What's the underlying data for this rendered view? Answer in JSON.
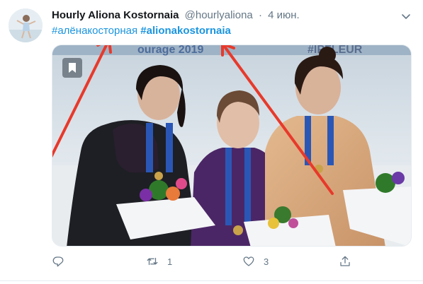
{
  "tweet": {
    "author_name": "Hourly Aliona Kostornaia",
    "handle": "@hourlyaliona",
    "separator": "·",
    "date": "4 июн.",
    "hashtags": [
      {
        "text": "#алёнакосторная",
        "bold": false
      },
      {
        "text": "#alionakostornaia",
        "bold": true
      }
    ]
  },
  "media": {
    "backdrop_text_left": "ourage 2019",
    "backdrop_text_right": "#IPFLEUR",
    "arrow_color": "#e8392b"
  },
  "actions": {
    "reply_count": "",
    "retweet_count": "1",
    "like_count": "3",
    "share_count": ""
  },
  "colors": {
    "link": "#1b95e0",
    "muted": "#657786",
    "border": "#e6ecf0"
  }
}
